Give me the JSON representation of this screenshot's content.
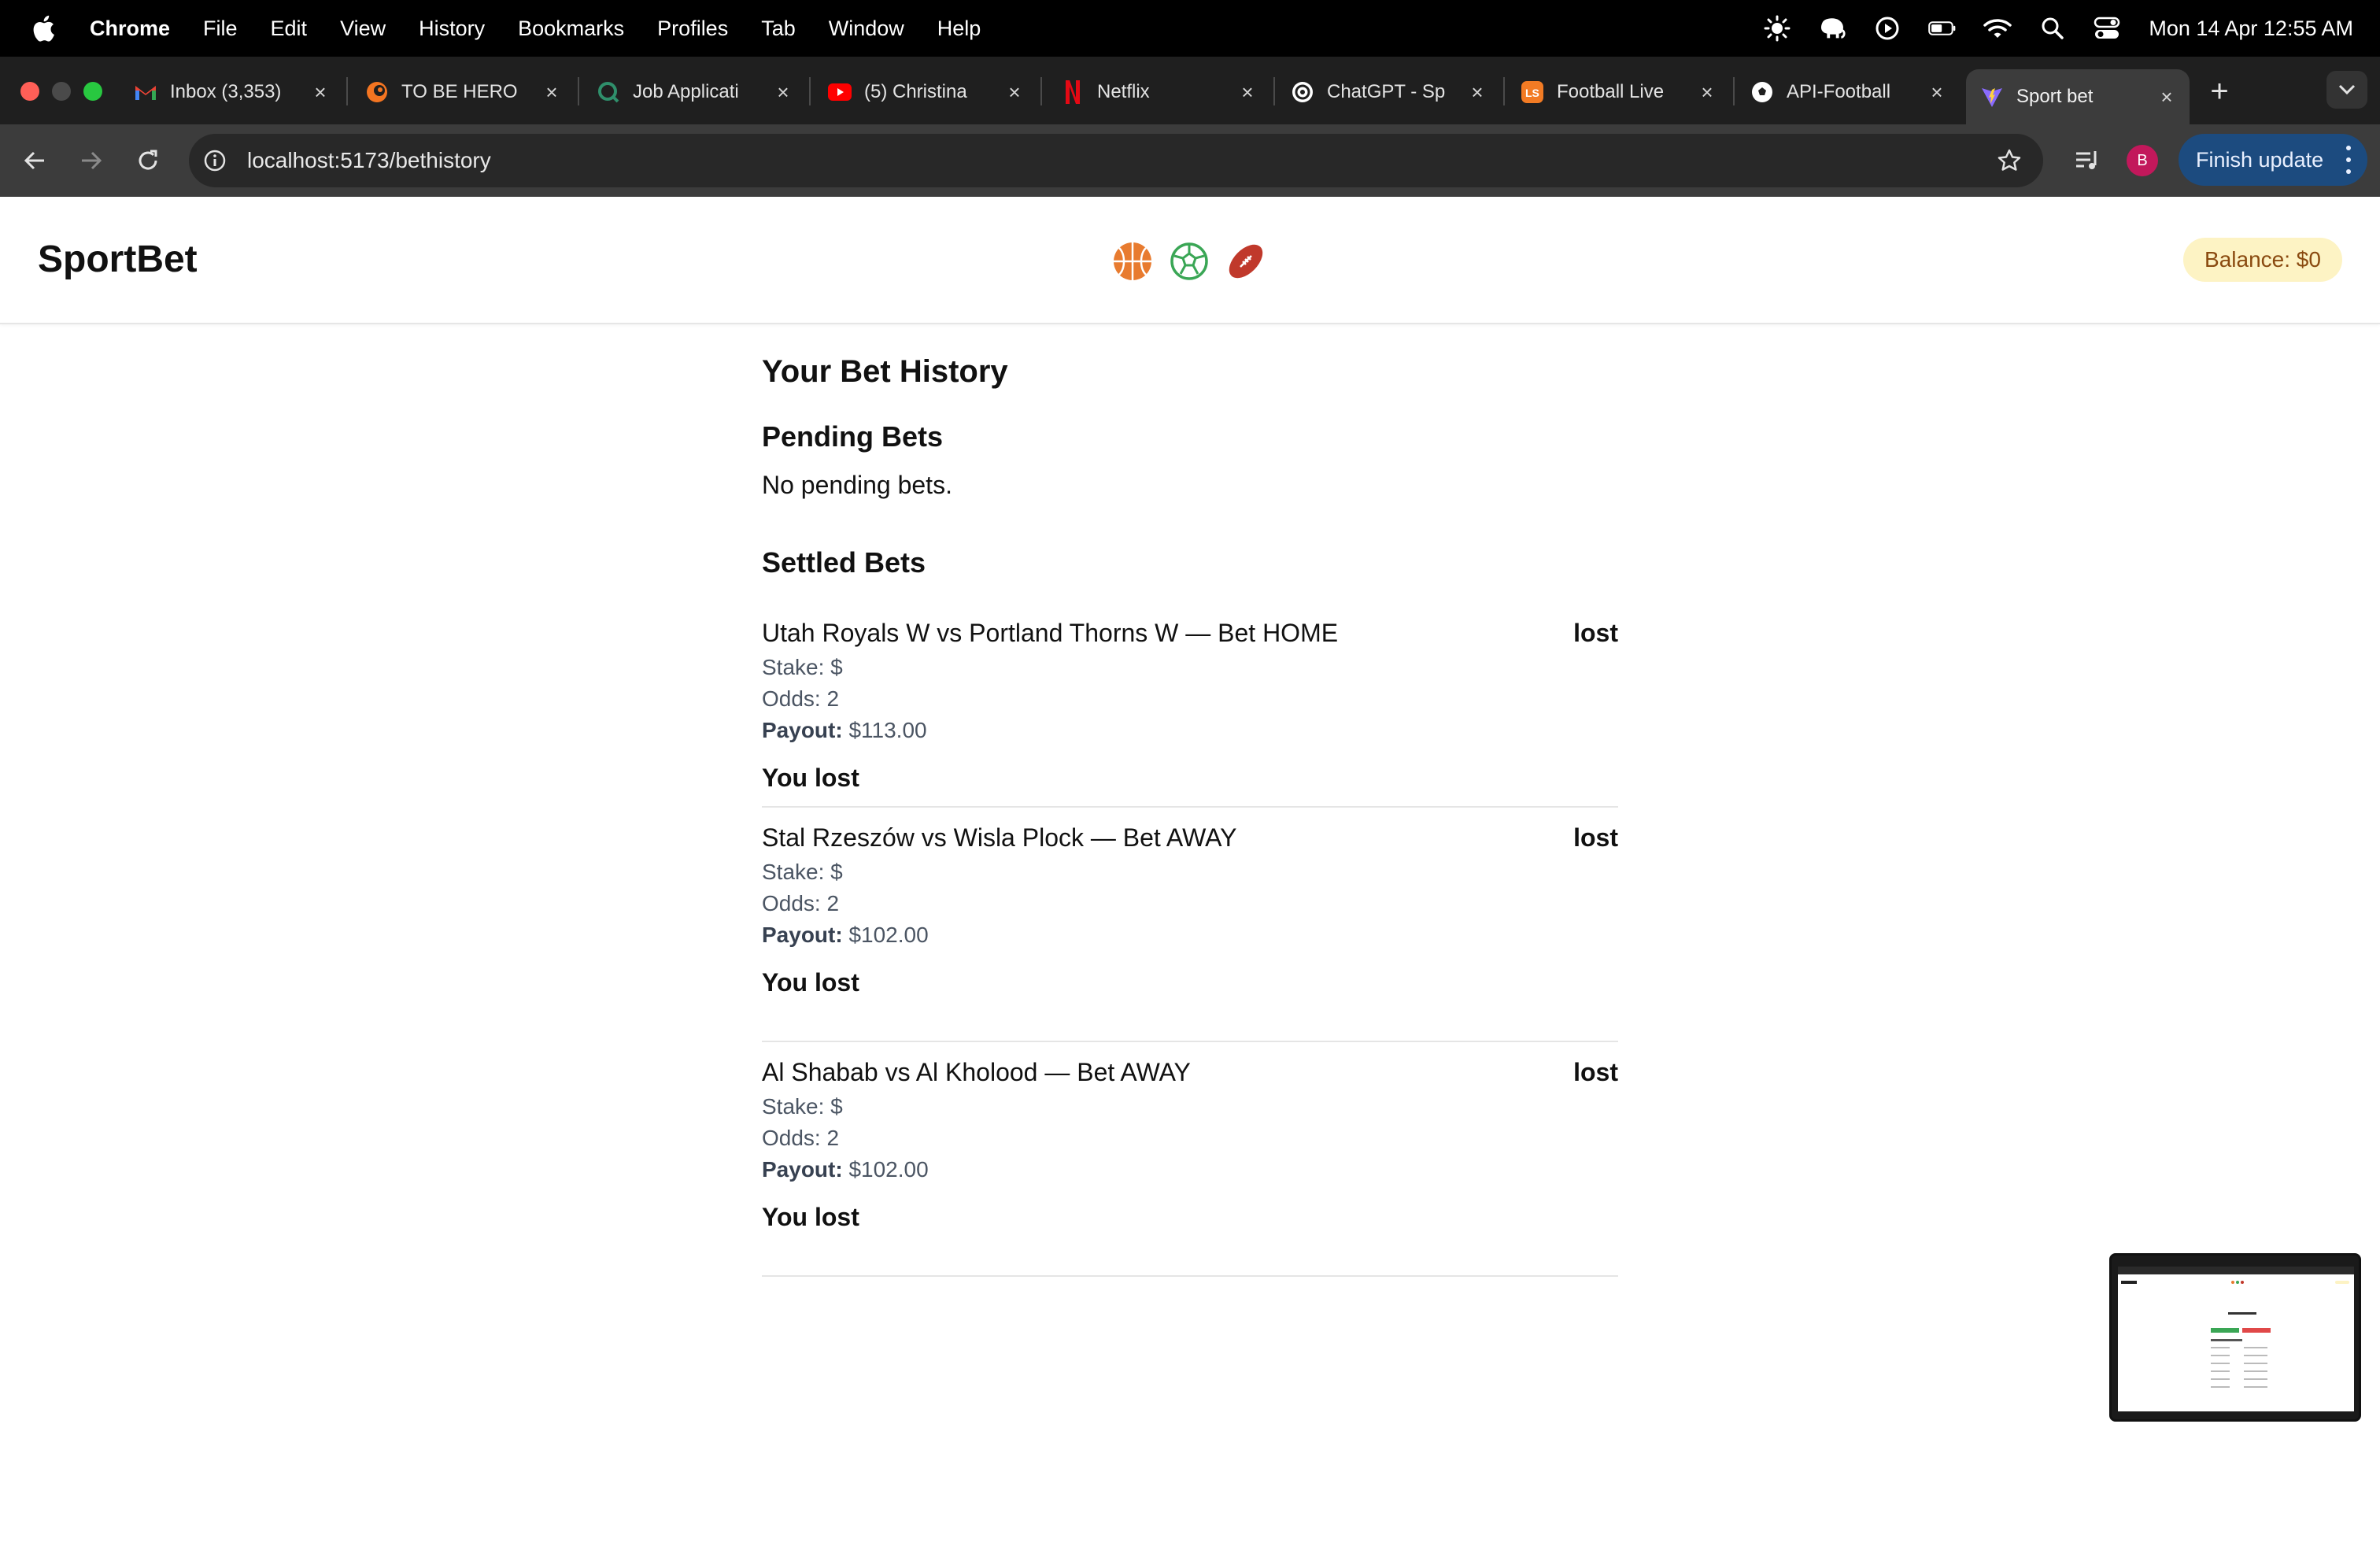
{
  "menubar": {
    "app": "Chrome",
    "items": [
      "File",
      "Edit",
      "View",
      "History",
      "Bookmarks",
      "Profiles",
      "Tab",
      "Window",
      "Help"
    ],
    "clock": "Mon 14 Apr  12:55 AM"
  },
  "tabs": [
    {
      "title": "Inbox (3,353)",
      "icon": "gmail-icon"
    },
    {
      "title": "TO BE HERO",
      "icon": "crunchyroll-icon"
    },
    {
      "title": "Job Applicati",
      "icon": "job-site-icon"
    },
    {
      "title": "(5) Christina",
      "icon": "youtube-icon"
    },
    {
      "title": "Netflix",
      "icon": "netflix-icon"
    },
    {
      "title": "ChatGPT - Sp",
      "icon": "chatgpt-icon"
    },
    {
      "title": "Football Live",
      "icon": "livescore-icon"
    },
    {
      "title": "API-Football",
      "icon": "football-icon"
    },
    {
      "title": "Sport bet",
      "icon": "vite-icon"
    }
  ],
  "toolbar": {
    "url": "localhost:5173/bethistory",
    "profile_initial": "B",
    "finish_update": "Finish update"
  },
  "site": {
    "brand": "SportBet",
    "balance": "Balance: $0",
    "sports": [
      "basketball-icon",
      "soccer-icon",
      "american-football-icon"
    ]
  },
  "history": {
    "title": "Your Bet History",
    "pending_title": "Pending Bets",
    "pending_empty": "No pending bets.",
    "settled_title": "Settled Bets",
    "payout_label": "Payout:",
    "bets": [
      {
        "match": "Utah Royals W vs Portland Thorns W — Bet HOME",
        "status": "lost",
        "stake": "Stake: $",
        "odds": "Odds: 2",
        "payout": "$113.00",
        "result": "You lost"
      },
      {
        "match": "Stal Rzeszów vs Wisla Plock — Bet AWAY",
        "status": "lost",
        "stake": "Stake: $",
        "odds": "Odds: 2",
        "payout": "$102.00",
        "result": "You lost"
      },
      {
        "match": "Al Shabab vs Al Kholood — Bet AWAY",
        "status": "lost",
        "stake": "Stake: $",
        "odds": "Odds: 2",
        "payout": "$102.00",
        "result": "You lost"
      }
    ]
  },
  "colors": {
    "balance_bg": "#fdf3c4",
    "balance_text": "#8a4a10",
    "basketball": "#e87b2f",
    "soccer": "#3aa655",
    "american_football": "#c0392b",
    "finish_update_bg": "#1c4b7f"
  }
}
